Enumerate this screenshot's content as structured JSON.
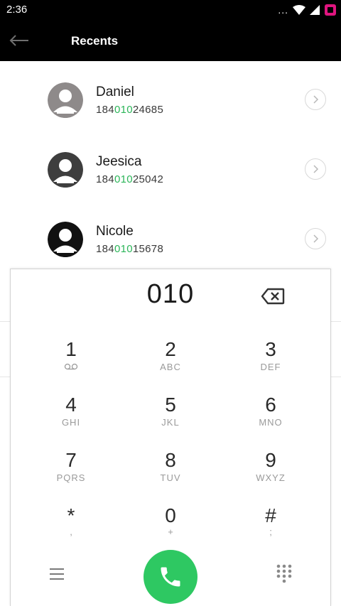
{
  "status_bar": {
    "time": "2:36",
    "dots": "..."
  },
  "app_bar": {
    "title": "Recents"
  },
  "recents": [
    {
      "name": "Daniel",
      "number_pre": "184",
      "number_match": "010",
      "number_post": "24685",
      "avatar_color": "#8e8a8a"
    },
    {
      "name": "Jeesica",
      "number_pre": "184",
      "number_match": "010",
      "number_post": "25042",
      "avatar_color": "#3e3e3e"
    },
    {
      "name": "Nicole",
      "number_pre": "184",
      "number_match": "010",
      "number_post": "15678",
      "avatar_color": "#111111"
    }
  ],
  "dialpad": {
    "input": "010",
    "keys": [
      {
        "digit": "1",
        "letters": ""
      },
      {
        "digit": "2",
        "letters": "ABC"
      },
      {
        "digit": "3",
        "letters": "DEF"
      },
      {
        "digit": "4",
        "letters": "GHI"
      },
      {
        "digit": "5",
        "letters": "JKL"
      },
      {
        "digit": "6",
        "letters": "MNO"
      },
      {
        "digit": "7",
        "letters": "PQRS"
      },
      {
        "digit": "8",
        "letters": "TUV"
      },
      {
        "digit": "9",
        "letters": "WXYZ"
      },
      {
        "digit": "*",
        "letters": ","
      },
      {
        "digit": "0",
        "letters": "+"
      },
      {
        "digit": "#",
        "letters": ";"
      }
    ]
  },
  "colors": {
    "accent_green": "#2ec862",
    "match_green": "#2db65a",
    "bar_black": "#000000"
  },
  "icons": {
    "back": "arrow-left-icon",
    "detail": "chevron-right-icon",
    "backspace": "backspace-icon",
    "voicemail": "voicemail-icon",
    "menu": "menu-icon",
    "call": "phone-icon",
    "keypad": "dialpad-icon"
  }
}
